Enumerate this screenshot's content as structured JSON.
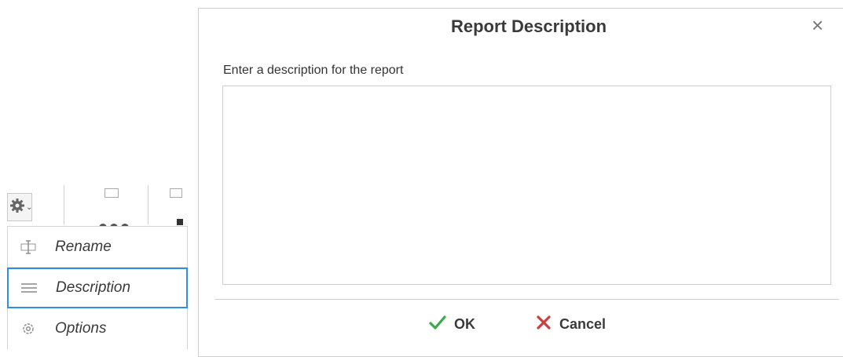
{
  "dialog": {
    "title": "Report Description",
    "close_label": "×",
    "prompt": "Enter a description for the report",
    "description_value": "",
    "ok_label": "OK",
    "cancel_label": "Cancel",
    "ok_icon": "check-icon",
    "cancel_icon": "x-icon",
    "colors": {
      "ok": "#3aaa4a",
      "cancel": "#c94040",
      "focus": "#2d8fe8"
    }
  },
  "menu": {
    "items": [
      {
        "label": "Rename",
        "icon": "rename-icon"
      },
      {
        "label": "Description",
        "icon": "lines-icon",
        "active": true
      },
      {
        "label": "Options",
        "icon": "options-gear-icon"
      }
    ]
  },
  "toolbar": {
    "settings_icon": "gear-icon"
  }
}
